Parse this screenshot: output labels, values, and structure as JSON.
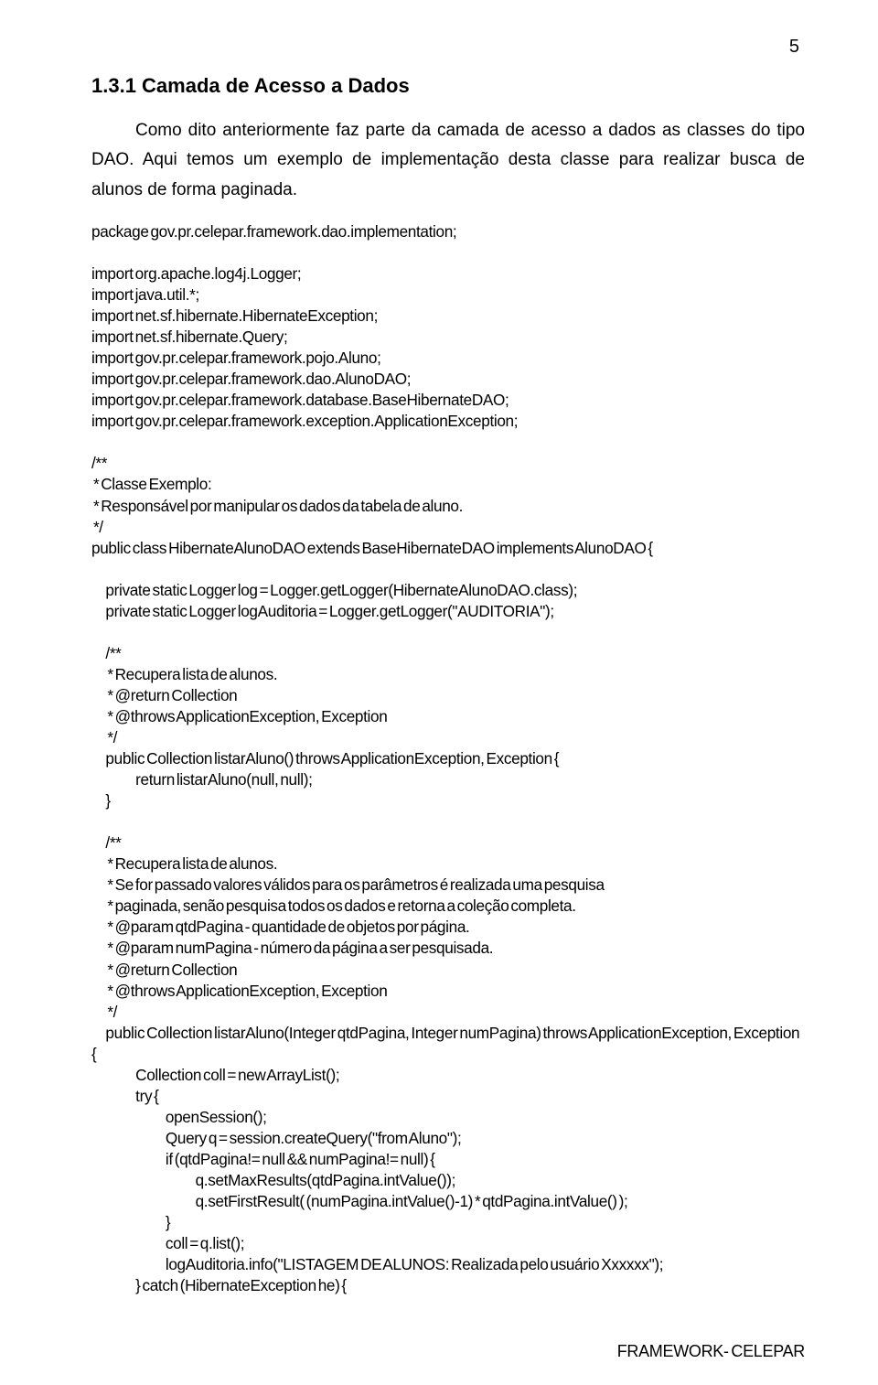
{
  "page_number": "5",
  "section_title": "1.3.1 Camada de Acesso a Dados",
  "paragraph": "Como dito anteriormente faz parte da camada de acesso a dados as classes do tipo DAO. Aqui temos um exemplo de implementação desta classe para realizar busca de alunos de forma paginada.",
  "code": "package gov.pr.celepar.framework.dao.implementation;\n\nimport org.apache.log4j.Logger;\nimport java.util.*;\nimport net.sf.hibernate.HibernateException;\nimport net.sf.hibernate.Query;\nimport gov.pr.celepar.framework.pojo.Aluno;\nimport gov.pr.celepar.framework.dao.AlunoDAO;\nimport gov.pr.celepar.framework.database.BaseHibernateDAO;\nimport gov.pr.celepar.framework.exception.ApplicationException;\n\n/**\n * Classe Exemplo:\n * Responsável por manipular os dados da tabela de aluno.\n */\npublic class HibernateAlunoDAO extends BaseHibernateDAO implements AlunoDAO {\n\n        private static Logger log = Logger.getLogger(HibernateAlunoDAO.class);\n        private static Logger logAuditoria = Logger.getLogger(\"AUDITORIA\");\n\n        /**\n         * Recupera lista de alunos.\n         * @return Collection\n         * @throws ApplicationException, Exception\n         */\n        public Collection listarAluno() throws ApplicationException, Exception {\n                         return listarAluno(null, null);\n        }\n\n        /**\n         * Recupera lista de alunos.\n         * Se for passado valores válidos para os parâmetros é realizada uma pesquisa\n         * paginada, senão pesquisa todos os dados e retorna a coleção completa.\n         * @param qtdPagina - quantidade de objetos por página.\n         * @param numPagina - número da página a ser pesquisada.\n         * @return Collection\n         * @throws ApplicationException, Exception\n         */\n        public Collection listarAluno(Integer qtdPagina, Integer numPagina) throws ApplicationException, Exception {\n                         Collection coll = new ArrayList();\n                         try {\n                                          openSession();\n                                          Query q = session.createQuery(\"from Aluno\");\n                                          if (qtdPagina!= null && numPagina!= null) {\n                                                           q.setMaxResults(qtdPagina.intValue());\n                                                           q.setFirstResult( (numPagina.intValue()-1) * qtdPagina.intValue() );\n                                          }\n                                          coll = q.list();\n                                          logAuditoria.info(\"LISTAGEM DE ALUNOS: Realizada pelo usuário Xxxxxx\");\n                         } catch (HibernateException he) {",
  "footer": "FRAMEWORK- CELEPAR"
}
